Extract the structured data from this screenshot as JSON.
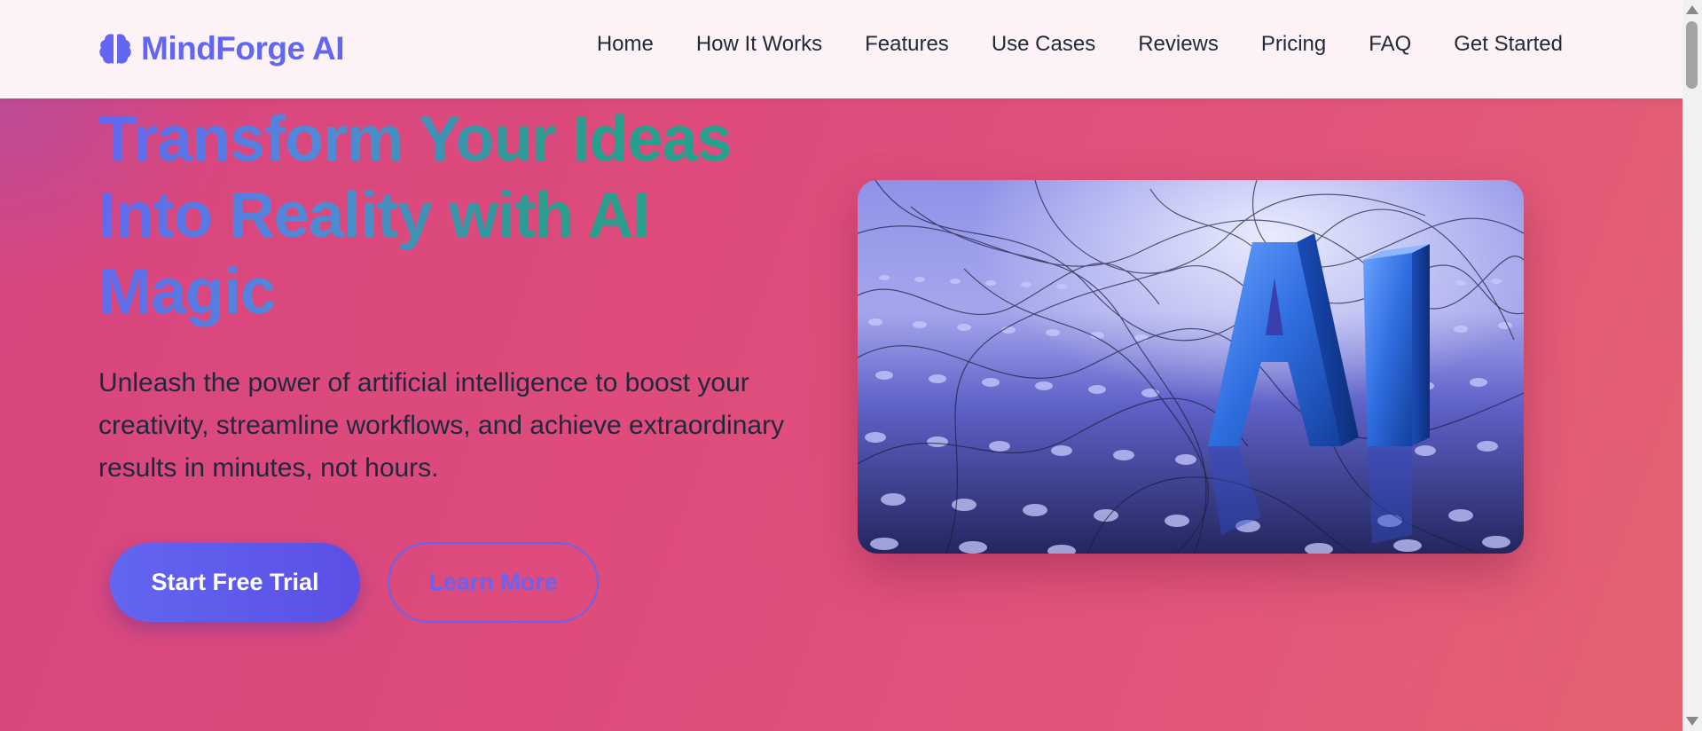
{
  "nav": {
    "brand": "MindForge AI",
    "brand_icon": "brain-icon",
    "links": [
      "Home",
      "How It Works",
      "Features",
      "Use Cases",
      "Reviews",
      "Pricing",
      "FAQ",
      "Get Started"
    ]
  },
  "hero": {
    "headline": "Transform Your Ideas Into Reality with AI Magic",
    "subtitle": "Unleash the power of artificial intelligence to boost your creativity, streamline workflows, and achieve extraordinary results in minutes, not hours.",
    "primary_button": "Start Free Trial",
    "secondary_button": "Learn More",
    "image_text": "AI"
  },
  "colors": {
    "accent": "#6366f1",
    "teal": "#20a58a",
    "hero_background": "#de4b7c",
    "nav_background": "#fdf3f7"
  }
}
